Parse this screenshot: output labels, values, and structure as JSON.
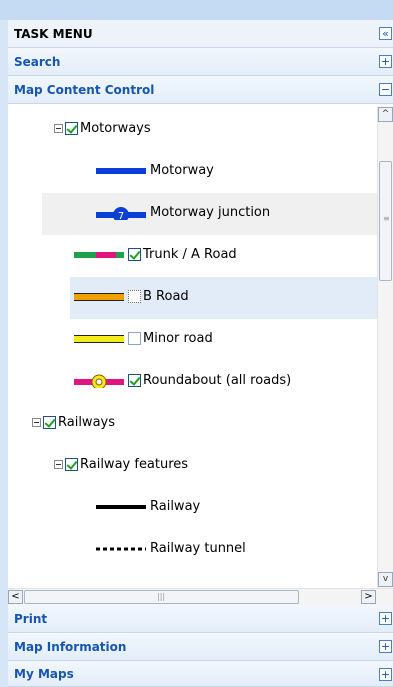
{
  "panel": {
    "title": "TASK MENU",
    "collapse_glyph": "«",
    "sections": {
      "search": {
        "label": "Search",
        "glyph": "+"
      },
      "map_content": {
        "label": "Map Content Control",
        "glyph": "−"
      },
      "print": {
        "label": "Print",
        "glyph": "+"
      },
      "map_info": {
        "label": "Map Information",
        "glyph": "+"
      },
      "my_maps": {
        "label": "My Maps",
        "glyph": "+"
      }
    }
  },
  "tree": {
    "motorways": {
      "label": "Motorways",
      "checked": true
    },
    "motorway": {
      "label": "Motorway"
    },
    "motorway_junction": {
      "label": "Motorway junction",
      "badge": "7"
    },
    "trunk": {
      "label": "Trunk / A Road",
      "checked": true
    },
    "b_road": {
      "label": "B Road",
      "checked": false
    },
    "minor": {
      "label": "Minor road",
      "checked": false
    },
    "roundabout": {
      "label": "Roundabout (all roads)",
      "checked": true
    },
    "railways": {
      "label": "Railways",
      "checked": true
    },
    "railway_features": {
      "label": "Railway features",
      "checked": true
    },
    "railway": {
      "label": "Railway"
    },
    "railway_tunnel": {
      "label": "Railway tunnel"
    }
  },
  "scrollbars": {
    "up": "^",
    "down": "v",
    "left": "<",
    "right": ">"
  },
  "colors": {
    "section_text": "#1556b3",
    "motorway_blue": "#0b3fd6",
    "trunk_green": "#1ca24a",
    "trunk_magenta": "#e0157f",
    "b_road_orange": "#f0a000",
    "minor_yellow": "#f4ec1a"
  }
}
